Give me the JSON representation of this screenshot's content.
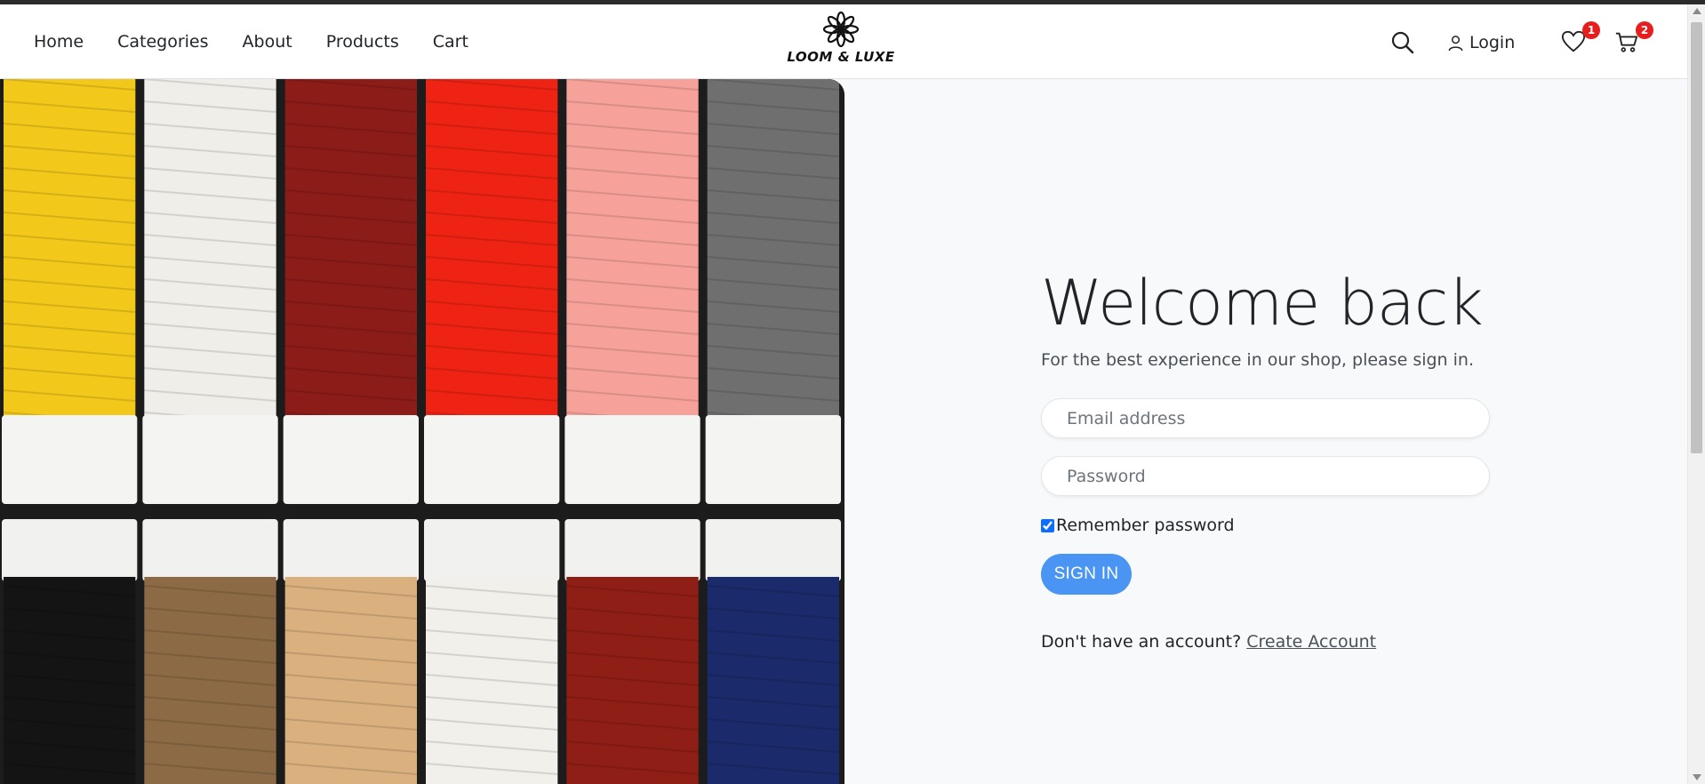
{
  "nav": {
    "links": [
      "Home",
      "Categories",
      "About",
      "Products",
      "Cart"
    ],
    "brand": "LOOM & LUXE",
    "login_label": "Login",
    "wishlist_count": "1",
    "cart_count": "2"
  },
  "hero": {
    "icon": "thread-spools-image",
    "top_spool_colors": [
      "#f2c81a",
      "#f0eee8",
      "#8c1c18",
      "#ee2313",
      "#f6a19a",
      "#6f6f6f"
    ],
    "bottom_spool_colors": [
      "#141414",
      "#8b6a45",
      "#d9b07e",
      "#f2f0eb",
      "#8f1e16",
      "#1b2a6a"
    ]
  },
  "form": {
    "title": "Welcome back",
    "subtitle": "For the best experience in our shop, please sign in.",
    "email_placeholder": "Email address",
    "password_placeholder": "Password",
    "remember_label": "Remember password",
    "remember_checked": true,
    "submit_label": "SIGN IN",
    "signup_prompt": "Don't have an account?",
    "signup_link": "Create Account"
  },
  "colors": {
    "accent": "#4a94f3",
    "badge": "#e61e1e"
  }
}
